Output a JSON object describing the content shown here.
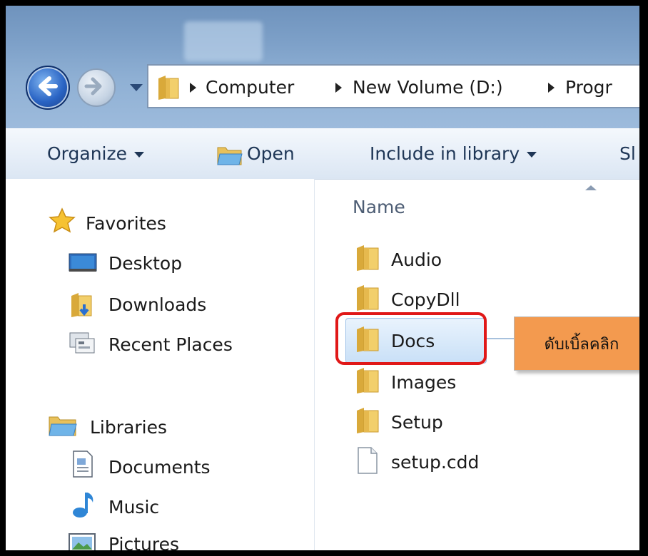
{
  "address_bar": {
    "crumbs": [
      "Computer",
      "New Volume (D:)",
      "Progr"
    ]
  },
  "toolbar": {
    "organize": "Organize",
    "open": "Open",
    "include_in_library": "Include in library",
    "share_partial": "Sl"
  },
  "nav_pane": {
    "favorites": {
      "header": "Favorites",
      "items": [
        "Desktop",
        "Downloads",
        "Recent Places"
      ]
    },
    "libraries": {
      "header": "Libraries",
      "items": [
        "Documents",
        "Music",
        "Pictures"
      ]
    }
  },
  "file_list": {
    "column_name": "Name",
    "items": [
      {
        "name": "Audio",
        "type": "folder"
      },
      {
        "name": "CopyDll",
        "type": "folder"
      },
      {
        "name": "Docs",
        "type": "folder",
        "selected": true
      },
      {
        "name": "Images",
        "type": "folder"
      },
      {
        "name": "Setup",
        "type": "folder"
      },
      {
        "name": "setup.cdd",
        "type": "file"
      }
    ]
  },
  "callout": {
    "text": "ดับเบิ้ลคลิก"
  },
  "colors": {
    "highlight": "#e01818",
    "callout_bg": "#f39a4f",
    "selection": "#c9e0f7"
  }
}
